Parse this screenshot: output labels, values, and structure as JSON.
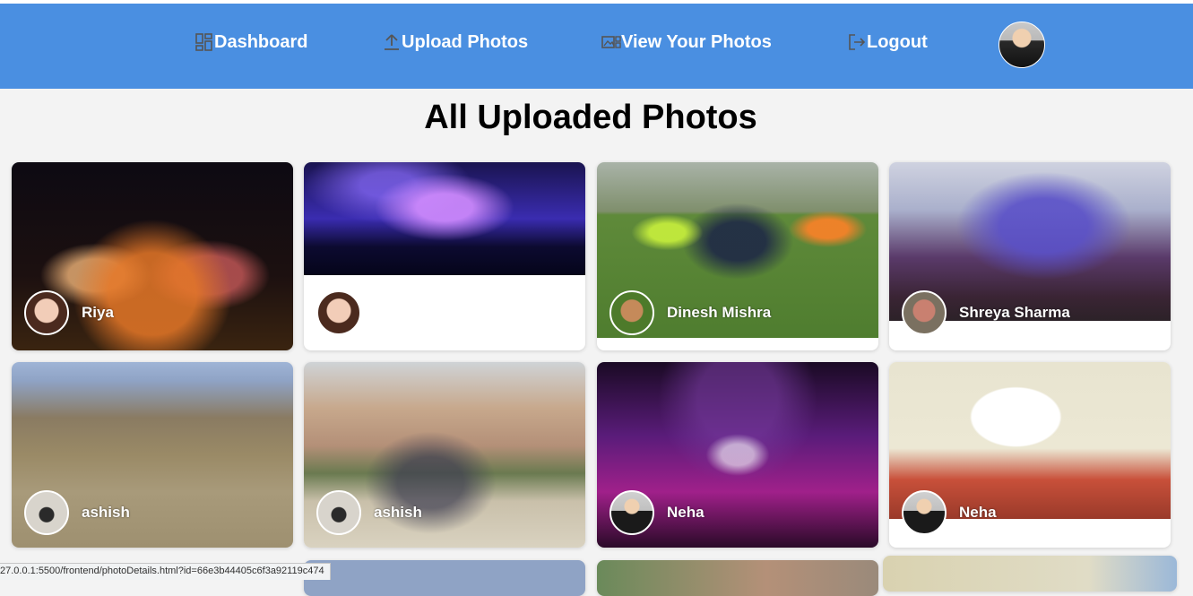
{
  "nav": {
    "items": [
      {
        "label": "Dashboard",
        "icon": "dashboard-icon"
      },
      {
        "label": "Upload Photos",
        "icon": "upload-icon"
      },
      {
        "label": "View Your Photos",
        "icon": "photos-icon"
      },
      {
        "label": "Logout",
        "icon": "logout-icon"
      }
    ],
    "color": "#4a8fe1"
  },
  "page": {
    "title": "All Uploaded Photos"
  },
  "photos": [
    {
      "uploader": "Riya"
    },
    {
      "uploader": ""
    },
    {
      "uploader": "Dinesh Mishra"
    },
    {
      "uploader": "Shreya Sharma"
    },
    {
      "uploader": "ashish"
    },
    {
      "uploader": "ashish"
    },
    {
      "uploader": "Neha"
    },
    {
      "uploader": "Neha"
    }
  ],
  "status": {
    "url": "27.0.0.1:5500/frontend/photoDetails.html?id=66e3b44405c6f3a92119c474"
  }
}
